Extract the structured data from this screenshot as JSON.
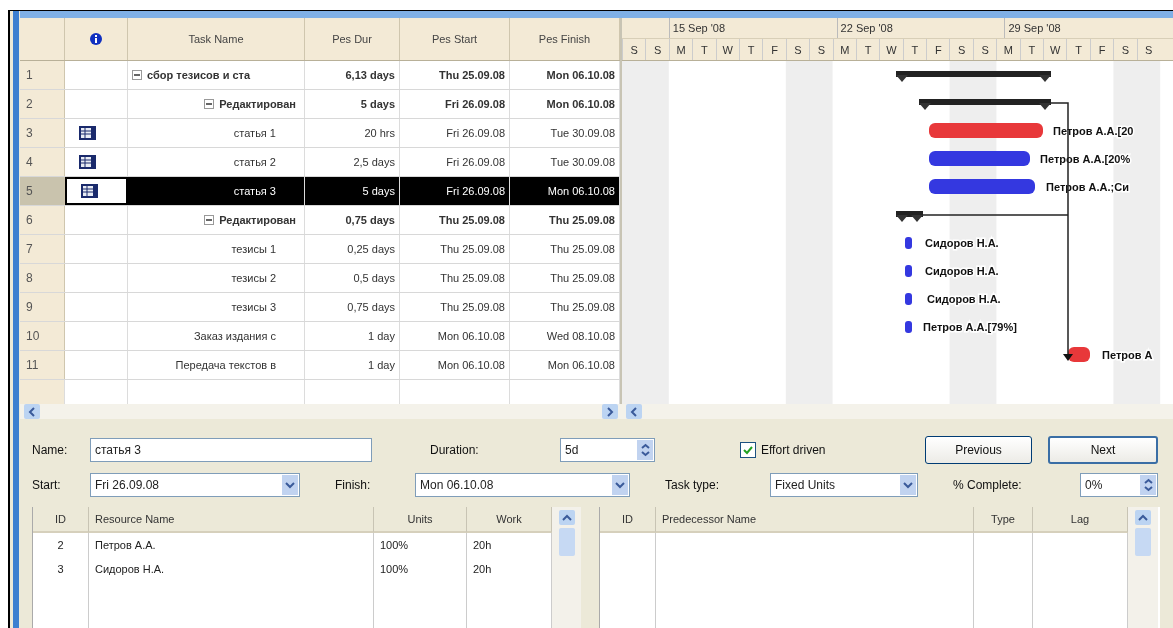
{
  "task_table": {
    "columns": [
      "Task Name",
      "Pes Dur",
      "Pes Start",
      "Pes Finish"
    ],
    "rows": [
      {
        "id": "1",
        "name": "сбор тезисов и ста",
        "duration": "6,13 days",
        "start": "Thu 25.09.08",
        "finish": "Mon 06.10.08",
        "kind": "summary",
        "expanded": true,
        "selected": false,
        "bar": {
          "kind": "summary"
        },
        "children": [
          {
            "id": "2",
            "name": "Редактирован",
            "duration": "5 days",
            "start": "Fri 26.09.08",
            "finish": "Mon 06.10.08",
            "kind": "summary",
            "expanded": true,
            "selected": false,
            "bar": {
              "kind": "summary"
            },
            "children": [
              {
                "id": "3",
                "name": "статья 1",
                "duration": "20 hrs",
                "start": "Fri 26.09.08",
                "finish": "Tue 30.09.08",
                "kind": "task",
                "note": true,
                "selected": false,
                "bar": {
                  "kind": "task",
                  "color": "#e8383a",
                  "label": "Петров А.А.[20"
                }
              },
              {
                "id": "4",
                "name": "статья 2",
                "duration": "2,5 days",
                "start": "Fri 26.09.08",
                "finish": "Tue 30.09.08",
                "kind": "task",
                "note": true,
                "selected": false,
                "bar": {
                  "kind": "task",
                  "color": "#3438e0",
                  "label": "Петров А.А.[20%"
                }
              },
              {
                "id": "5",
                "name": "статья 3",
                "duration": "5 days",
                "start": "Fri 26.09.08",
                "finish": "Mon 06.10.08",
                "kind": "task",
                "note": true,
                "selected": true,
                "bar": {
                  "kind": "task",
                  "color": "#3438e0",
                  "label": "Петров А.А.;Си"
                }
              }
            ]
          },
          {
            "id": "6",
            "name": "Редактирован",
            "duration": "0,75 days",
            "start": "Thu 25.09.08",
            "finish": "Thu 25.09.08",
            "kind": "summary",
            "expanded": true,
            "selected": false,
            "bar": {
              "kind": "summary"
            },
            "children": [
              {
                "id": "7",
                "name": "тезисы 1",
                "duration": "0,25 days",
                "start": "Thu 25.09.08",
                "finish": "Thu 25.09.08",
                "kind": "task",
                "note": false,
                "selected": false,
                "bar": {
                  "kind": "task",
                  "color": "#3438e0",
                  "label": "Сидоров Н.А."
                }
              },
              {
                "id": "8",
                "name": "тезисы 2",
                "duration": "0,5 days",
                "start": "Thu 25.09.08",
                "finish": "Thu 25.09.08",
                "kind": "task",
                "note": false,
                "selected": false,
                "bar": {
                  "kind": "task",
                  "color": "#3438e0",
                  "label": "Сидоров Н.А."
                }
              },
              {
                "id": "9",
                "name": "тезисы 3",
                "duration": "0,75 days",
                "start": "Thu 25.09.08",
                "finish": "Thu 25.09.08",
                "kind": "task",
                "note": false,
                "selected": false,
                "bar": {
                  "kind": "task",
                  "color": "#3438e0",
                  "label": "Сидоров Н.А."
                }
              }
            ]
          },
          {
            "id": "10",
            "name": "Заказ издания с",
            "duration": "1 day",
            "start": "Mon 06.10.08",
            "finish": "Wed 08.10.08",
            "kind": "task",
            "note": false,
            "selected": false,
            "bar": {
              "kind": "task",
              "color": "#3438e0",
              "label": "Петров А.А.[79%]"
            }
          },
          {
            "id": "11",
            "name": "Передача текстов в",
            "duration": "1 day",
            "start": "Mon 06.10.08",
            "finish": "Mon 06.10.08",
            "kind": "task",
            "note": false,
            "selected": false,
            "bar": {
              "kind": "task",
              "color": "#e8383a",
              "label": "Петров А"
            }
          }
        ]
      }
    ]
  },
  "gantt": {
    "weeks": [
      "15 Sep '08",
      "22 Sep '08",
      "29 Sep '08"
    ],
    "days": [
      "S",
      "S",
      "M",
      "T",
      "W",
      "T",
      "F",
      "S",
      "S",
      "M",
      "T",
      "W",
      "T",
      "F",
      "S",
      "S",
      "M",
      "T",
      "W",
      "T",
      "F",
      "S",
      "S"
    ]
  },
  "task_form": {
    "name": {
      "label": "Name:",
      "value": "статья 3"
    },
    "duration": {
      "label": "Duration:",
      "value": "5d"
    },
    "effort_driven": {
      "label": "Effort driven",
      "checked": true
    },
    "buttons": [
      {
        "label": "Previous",
        "focused": false
      },
      {
        "label": "Next",
        "focused": true
      }
    ],
    "start": {
      "label": "Start:",
      "value": "Fri 26.09.08"
    },
    "finish": {
      "label": "Finish:",
      "value": "Mon 06.10.08"
    },
    "task_type": {
      "label": "Task type:",
      "value": "Fixed Units"
    },
    "percent_complete": {
      "label": "% Complete:",
      "value": "0%"
    }
  },
  "resources": {
    "columns": [
      "ID",
      "Resource Name",
      "Units",
      "Work"
    ],
    "rows": [
      [
        "2",
        "Петров А.А.",
        "100%",
        "20h"
      ],
      [
        "3",
        "Сидоров Н.А.",
        "100%",
        "20h"
      ]
    ]
  },
  "predecessors": {
    "columns": [
      "ID",
      "Predecessor Name",
      "Type",
      "Lag"
    ]
  }
}
